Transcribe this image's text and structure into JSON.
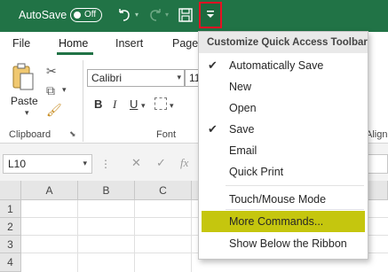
{
  "titlebar": {
    "autosave_label": "AutoSave",
    "autosave_state": "Off",
    "bg_color": "#217346",
    "icons": [
      "undo-icon",
      "redo-icon",
      "save-icon",
      "customize-qat-icon"
    ]
  },
  "tabs": [
    {
      "label": "File",
      "active": false
    },
    {
      "label": "Home",
      "active": true
    },
    {
      "label": "Insert",
      "active": false
    },
    {
      "label": "Page",
      "active": false
    }
  ],
  "ribbon": {
    "clipboard": {
      "paste_label": "Paste",
      "group_label": "Clipboard"
    },
    "font": {
      "font_name": "Calibri",
      "font_size": "11",
      "bold": "B",
      "italic": "I",
      "underline": "U",
      "group_label": "Font"
    },
    "alignment_partial": "Alignm"
  },
  "formula_bar": {
    "name_box": "L10"
  },
  "grid": {
    "columns": [
      "A",
      "B",
      "C"
    ],
    "rows": [
      "1",
      "2",
      "3",
      "4"
    ]
  },
  "menu": {
    "header": "Customize Quick Access Toolbar",
    "items": [
      {
        "label": "Automatically Save",
        "checked": true
      },
      {
        "label": "New",
        "checked": false
      },
      {
        "label": "Open",
        "checked": false
      },
      {
        "label": "Save",
        "checked": true
      },
      {
        "label": "Email",
        "checked": false
      },
      {
        "label": "Quick Print",
        "checked": false
      },
      {
        "label": "Touch/Mouse Mode",
        "checked": false
      },
      {
        "label": "More Commands...",
        "checked": false,
        "highlighted": true
      },
      {
        "label": "Show Below the Ribbon",
        "checked": false
      }
    ],
    "highlight_color": "#c5c60e"
  }
}
